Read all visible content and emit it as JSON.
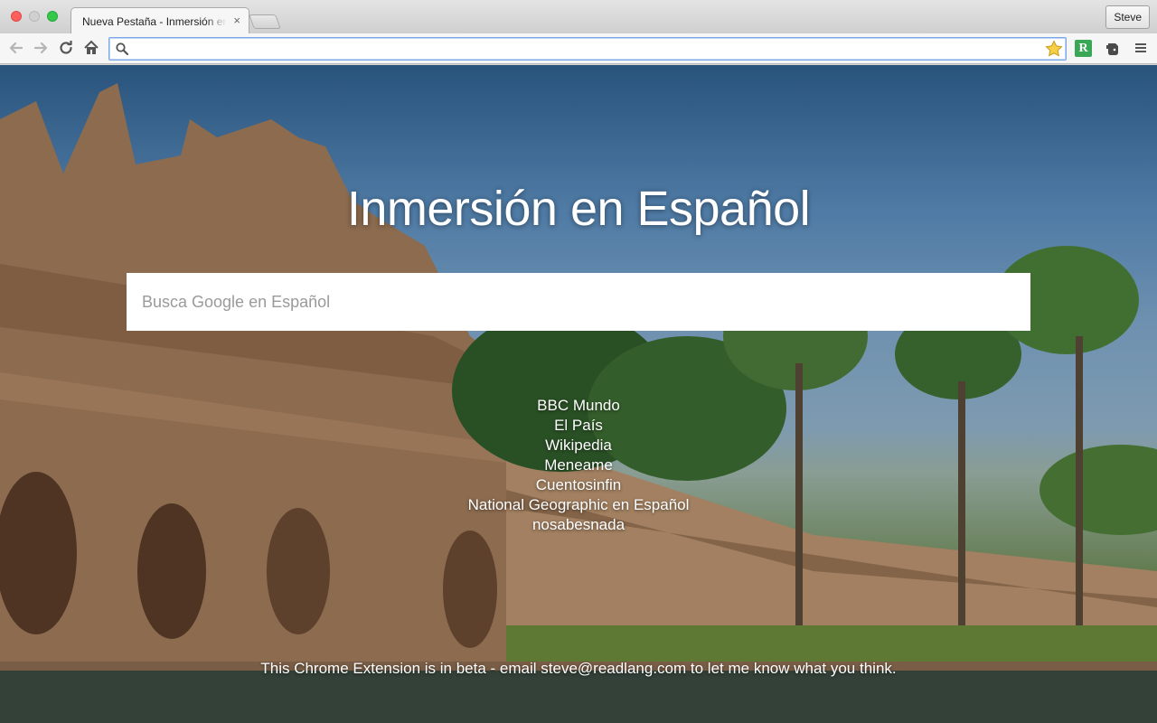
{
  "browser": {
    "tab_title": "Nueva Pestaña - Inmersión en Español",
    "tab_close_label": "×",
    "profile_name": "Steve",
    "address_value": "",
    "extension_readlang_label": "R",
    "icons": {
      "back": "back-arrow-icon",
      "forward": "forward-arrow-icon",
      "reload": "reload-icon",
      "home": "home-icon",
      "search": "search-icon",
      "bookmark": "star-icon",
      "readlang": "readlang-extension-icon",
      "evernote": "evernote-extension-icon",
      "menu": "hamburger-menu-icon"
    }
  },
  "page": {
    "title": "Inmersión en Español",
    "search_placeholder": "Busca Google en Español",
    "links": [
      "BBC Mundo",
      "El País",
      "Wikipedia",
      "Meneame",
      "Cuentosinfin",
      "National Geographic en Español",
      "nosabesnada"
    ],
    "footer": {
      "before": "This Chrome Extension is in beta - email ",
      "email": "steve@readlang.com",
      "after": " to let me know what you think."
    }
  },
  "colors": {
    "accent_focus": "#7aa7e6",
    "readlang_green": "#3aa757",
    "text_on_image": "#ffffff"
  }
}
